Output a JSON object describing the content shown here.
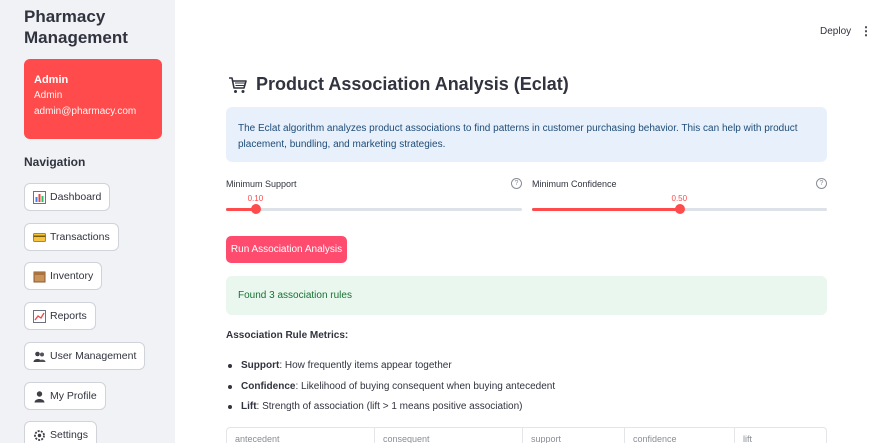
{
  "app": {
    "title": "Pharmacy Management"
  },
  "user": {
    "role": "Admin",
    "name": "Admin",
    "email": "admin@pharmacy.com"
  },
  "nav": {
    "heading": "Navigation",
    "items": [
      {
        "label": "Dashboard",
        "icon": "bar-chart-icon"
      },
      {
        "label": "Transactions",
        "icon": "credit-card-icon"
      },
      {
        "label": "Inventory",
        "icon": "box-icon"
      },
      {
        "label": "Reports",
        "icon": "chart-icon"
      },
      {
        "label": "User Management",
        "icon": "users-icon"
      },
      {
        "label": "My Profile",
        "icon": "user-icon"
      },
      {
        "label": "Settings",
        "icon": "gear-icon"
      }
    ]
  },
  "header": {
    "deploy_label": "Deploy",
    "menu_glyph": "⋮"
  },
  "page": {
    "title": "Product Association Analysis (Eclat)",
    "title_icon": "cart-icon",
    "info": "The Eclat algorithm analyzes product associations to find patterns in customer purchasing behavior. This can help with product placement, bundling, and marketing strategies."
  },
  "sliders": {
    "support": {
      "label": "Minimum Support",
      "value": "0.10",
      "fraction": 0.1
    },
    "confidence": {
      "label": "Minimum Confidence",
      "value": "0.50",
      "fraction": 0.5
    }
  },
  "run_button": "Run Association Analysis",
  "result": "Found 3 association rules",
  "metrics": {
    "heading": "Association Rule Metrics:",
    "items": [
      {
        "term": "Support",
        "desc": ": How frequently items appear together"
      },
      {
        "term": "Confidence",
        "desc": ": Likelihood of buying consequent when buying antecedent"
      },
      {
        "term": "Lift",
        "desc": ": Strength of association (lift > 1 means positive association)"
      }
    ]
  },
  "table": {
    "columns": [
      "antecedent",
      "consequent",
      "support",
      "confidence",
      "lift"
    ]
  },
  "colors": {
    "accent": "#ff4b4b",
    "button": "#ff4b6e",
    "info_bg": "#e8f1fb",
    "success_bg": "#e9f7ef",
    "sidebar_bg": "#f0f2f6"
  }
}
